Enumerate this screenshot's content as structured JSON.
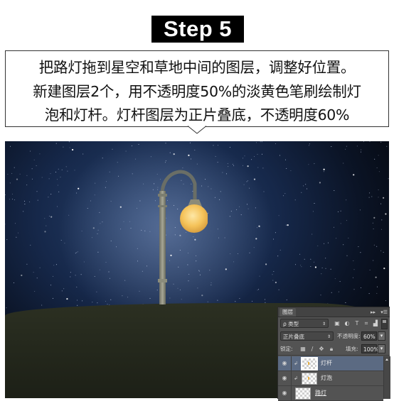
{
  "step": {
    "label": "Step 5"
  },
  "instructions": {
    "lines": [
      "把路灯拖到星空和草地中间的图层，调整好位置。",
      "新建图层2个，用不透明度50%的淡黄色笔刷绘制灯",
      "泡和灯杆。灯杆图层为正片叠底，不透明度60%"
    ]
  },
  "scene": {
    "description": "Street lamp composited onto starry night sky above a grassy hill",
    "lamp_glow_color": "#f5c35a",
    "sky_color": "#16284a",
    "grass_color": "#2a2e20"
  },
  "layers_panel": {
    "title": "图层",
    "collapse_icon": "double-arrow-right-icon",
    "menu_icon": "panel-menu-icon",
    "filter": {
      "kind_label": "ρ 类型",
      "icons": [
        "image-filter-icon",
        "adjustment-filter-icon",
        "type-filter-icon",
        "shape-filter-icon",
        "smart-object-filter-icon"
      ]
    },
    "blend_mode": "正片叠底",
    "opacity_label": "不透明度:",
    "opacity_value": "60%",
    "lock_label": "锁定:",
    "lock_icons": [
      "lock-transparent-icon",
      "lock-image-icon",
      "lock-position-icon",
      "lock-all-icon"
    ],
    "fill_label": "填充:",
    "fill_value": "100%",
    "layers": [
      {
        "name": "灯杆",
        "visible": true,
        "clipped": true,
        "selected": true
      },
      {
        "name": "灯泡",
        "visible": true,
        "clipped": true,
        "selected": false
      },
      {
        "name": "路灯",
        "visible": true,
        "clipped": false,
        "selected": false
      }
    ]
  },
  "icons": {
    "eye": "👁",
    "clip": "↲",
    "caret": "⇕",
    "dropdown": "▾"
  }
}
